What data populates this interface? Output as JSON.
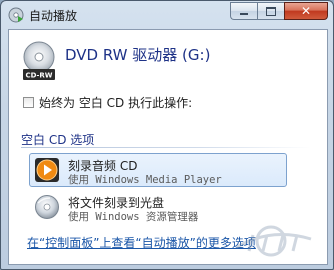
{
  "window": {
    "title": "自动播放"
  },
  "drive": {
    "title": "DVD RW 驱动器 (G:)",
    "icon_label": "CD-RW"
  },
  "always": {
    "label": "始终为 空白 CD 执行此操作:",
    "checked": false
  },
  "section": {
    "header": "空白 CD 选项"
  },
  "options": [
    {
      "title": "刻录音频 CD",
      "subtitle": "使用 Windows Media Player",
      "icon": "media-player-icon",
      "selected": true
    },
    {
      "title": "将文件刻录到光盘",
      "subtitle": "使用 Windows 资源管理器",
      "icon": "disc-burn-icon",
      "selected": false
    }
  ],
  "footer": {
    "link": "在“控制面板”上查看“自动播放”的更多选项"
  },
  "colors": {
    "title_blue": "#1e3287",
    "link_blue": "#1a56a8",
    "close_red": "#c0391f",
    "selection": "#dbeafb"
  }
}
